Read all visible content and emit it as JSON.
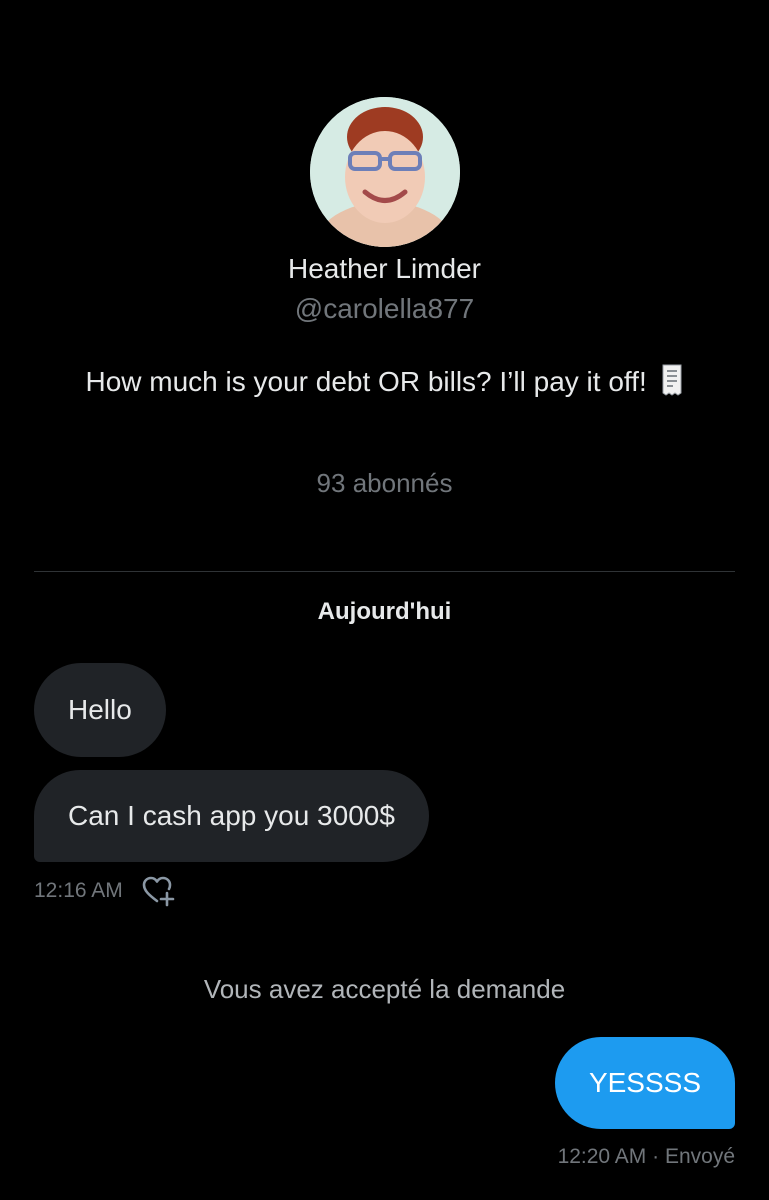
{
  "profile": {
    "name": "Heather Limder",
    "handle": "@carolella877",
    "bio": "How much is your debt OR bills? I’ll pay it off!",
    "bio_emoji_icon": "receipt-icon",
    "followers": "93 abonnés"
  },
  "conversation": {
    "day_label": "Aujourd'hui",
    "incoming": [
      {
        "text": "Hello"
      },
      {
        "text": "Can I cash app you 3000$"
      }
    ],
    "incoming_time": "12:16 AM",
    "react_icon": "heart-plus-icon",
    "system_note": "Vous avez accepté la demande",
    "outgoing": [
      {
        "text": "YESSSS"
      }
    ],
    "outgoing_status": "12:20 AM · Envoyé"
  },
  "colors": {
    "background": "#000000",
    "incoming_bubble": "#202327",
    "outgoing_bubble": "#1d9bf0",
    "muted_text": "#71767b"
  }
}
